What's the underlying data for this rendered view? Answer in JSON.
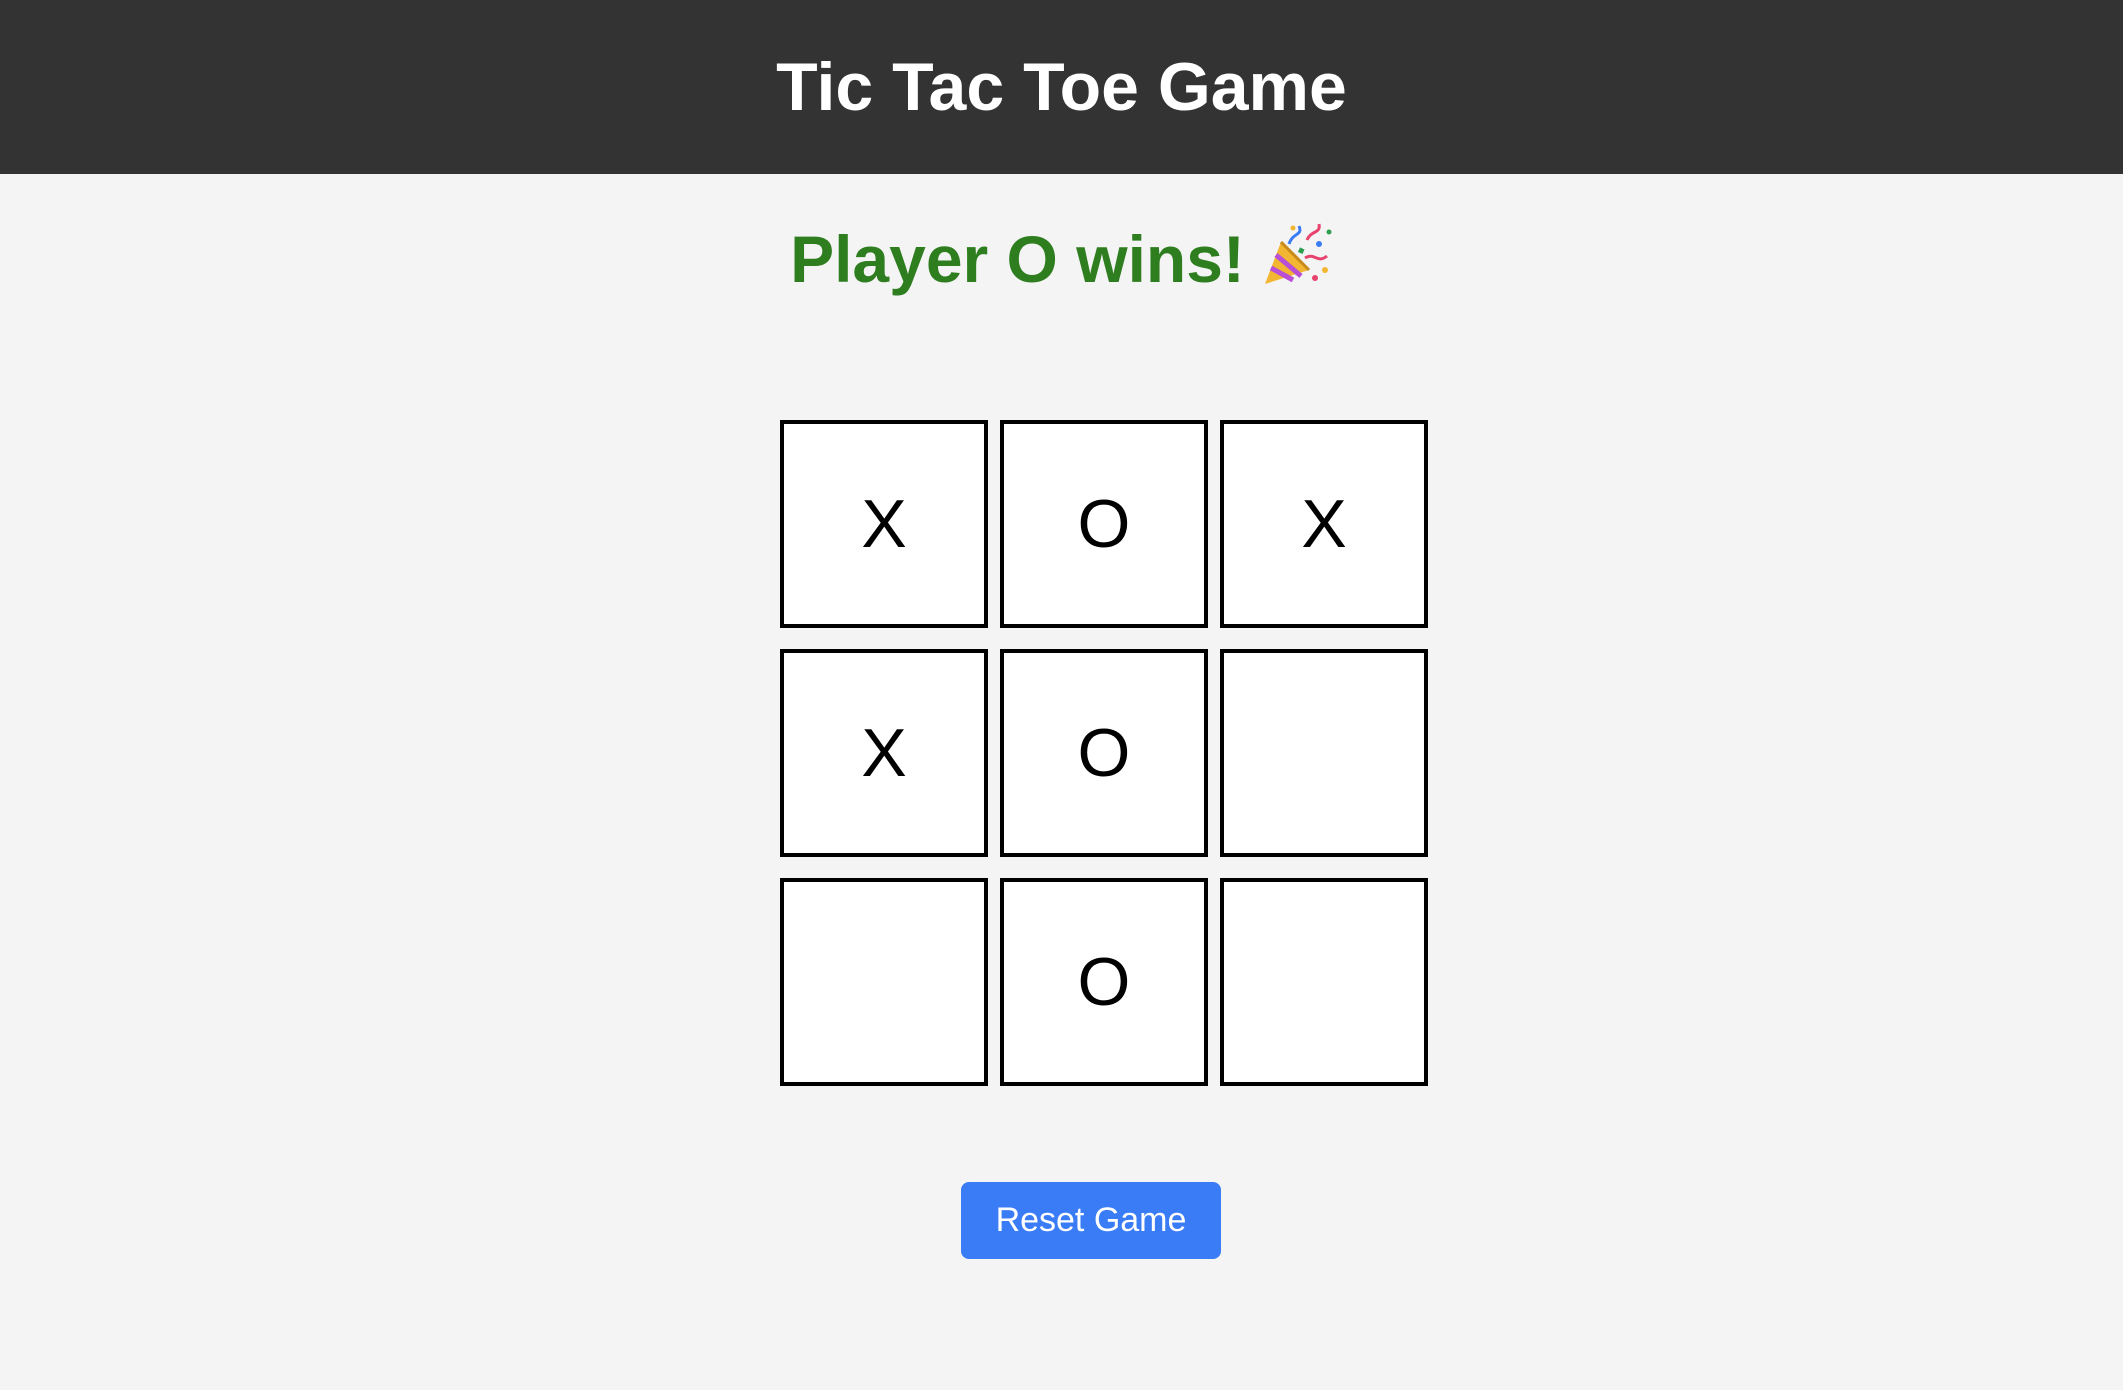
{
  "header": {
    "title": "Tic Tac Toe Game"
  },
  "status": {
    "message": "Player O wins!",
    "icon": "party-popper-icon"
  },
  "board": {
    "cells": [
      "X",
      "O",
      "X",
      "X",
      "O",
      "",
      "",
      "O",
      ""
    ],
    "winner": "O"
  },
  "controls": {
    "reset_label": "Reset Game"
  },
  "colors": {
    "header_bg": "#333333",
    "page_bg": "#f4f4f4",
    "win_text": "#2e7d1f",
    "button_bg": "#3a7cf6"
  }
}
